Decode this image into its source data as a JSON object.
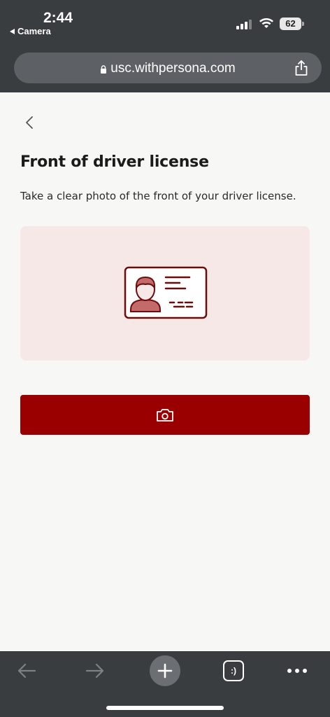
{
  "status_bar": {
    "time": "2:44",
    "back_app": "Camera",
    "battery": "62"
  },
  "url_bar": {
    "url": "usc.withpersona.com"
  },
  "page": {
    "title": "Front of driver license",
    "subtitle": "Take a clear photo of the front of your driver license."
  },
  "toolbar": {
    "tabs_label": ":)"
  },
  "colors": {
    "accent": "#9b0000",
    "illustration_bg": "#f7e8e8",
    "card_outline": "#6e0b0b",
    "card_fill": "#c36a6a"
  },
  "icons": {
    "back": "chevron-left-icon",
    "camera": "camera-icon",
    "share": "share-icon",
    "lock": "lock-icon"
  }
}
